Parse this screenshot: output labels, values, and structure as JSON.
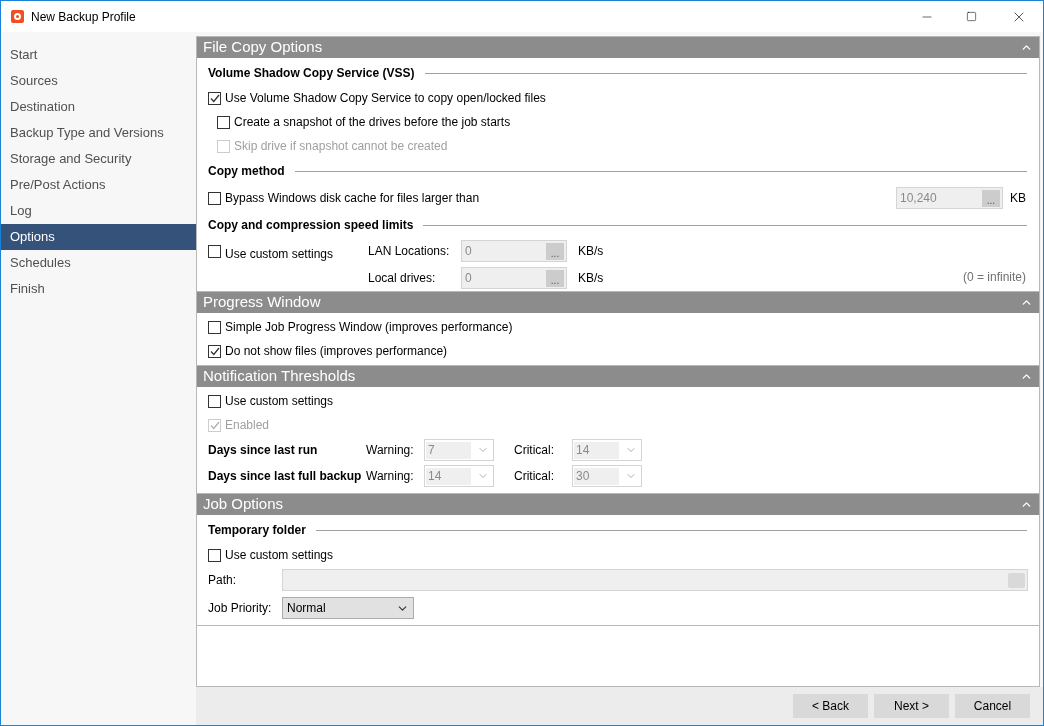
{
  "window": {
    "title": "New Backup Profile"
  },
  "sidebar": {
    "items": [
      {
        "label": "Start",
        "selected": false
      },
      {
        "label": "Sources",
        "selected": false
      },
      {
        "label": "Destination",
        "selected": false
      },
      {
        "label": "Backup Type and Versions",
        "selected": false
      },
      {
        "label": "Storage and Security",
        "selected": false
      },
      {
        "label": "Pre/Post Actions",
        "selected": false
      },
      {
        "label": "Log",
        "selected": false
      },
      {
        "label": "Options",
        "selected": true
      },
      {
        "label": "Schedules",
        "selected": false
      },
      {
        "label": "Finish",
        "selected": false
      }
    ]
  },
  "sections": [
    {
      "title": "File Copy Options",
      "expanded": true,
      "items": [
        {
          "kind": "heading",
          "label": "Volume Shadow Copy Service (VSS)"
        },
        {
          "kind": "checkbox",
          "label": "Use Volume Shadow Copy Service to copy open/locked files",
          "checked": true,
          "disabled": false,
          "children": [
            {
              "label": "Create a snapshot of the drives before the job starts",
              "checked": false,
              "disabled": false
            },
            {
              "label": "Skip drive if snapshot cannot be created",
              "checked": false,
              "disabled": true
            }
          ]
        },
        {
          "kind": "heading",
          "label": "Copy method"
        },
        {
          "kind": "checkfield",
          "label": "Bypass Windows disk cache for files larger than",
          "checked": false,
          "value": "10,240",
          "button": "...",
          "unit": "KB"
        },
        {
          "kind": "heading",
          "label": "Copy and compression speed limits"
        },
        {
          "kind": "limits",
          "checkbox": {
            "label": "Use custom settings",
            "checked": false
          },
          "fields": [
            {
              "label": "LAN Locations:",
              "value": "0",
              "button": "...",
              "unit": "KB/s"
            },
            {
              "label": "Local drives:",
              "value": "0",
              "button": "...",
              "unit": "KB/s"
            }
          ],
          "note": "(0 = infinite)"
        }
      ]
    },
    {
      "title": "Progress Window",
      "expanded": true,
      "items": [
        {
          "kind": "checkbox",
          "label": "Simple Job Progress Window (improves performance)",
          "checked": false,
          "disabled": false
        },
        {
          "kind": "checkbox",
          "label": "Do not show files (improves performance)",
          "checked": true,
          "disabled": false
        }
      ]
    },
    {
      "title": "Notification Thresholds",
      "expanded": true,
      "items": [
        {
          "kind": "checkbox",
          "label": "Use custom settings",
          "checked": false,
          "disabled": false
        },
        {
          "kind": "checkbox",
          "label": "Enabled",
          "checked": true,
          "disabled": true
        },
        {
          "kind": "thresholds",
          "rows": [
            {
              "label": "Days since last run",
              "fields": [
                {
                  "label": "Warning:",
                  "value": "7"
                },
                {
                  "label": "Critical:",
                  "value": "14"
                }
              ]
            },
            {
              "label": "Days since last full backup",
              "fields": [
                {
                  "label": "Warning:",
                  "value": "14"
                },
                {
                  "label": "Critical:",
                  "value": "30"
                }
              ]
            }
          ]
        }
      ]
    },
    {
      "title": "Job Options",
      "expanded": true,
      "items": [
        {
          "kind": "heading",
          "label": "Temporary folder"
        },
        {
          "kind": "checkbox",
          "label": "Use custom settings",
          "checked": false,
          "disabled": false
        },
        {
          "kind": "path",
          "label": "Path:"
        },
        {
          "kind": "select",
          "label": "Job Priority:",
          "value": "Normal"
        }
      ]
    }
  ],
  "buttons": [
    "< Back",
    "Next >",
    "Cancel"
  ]
}
